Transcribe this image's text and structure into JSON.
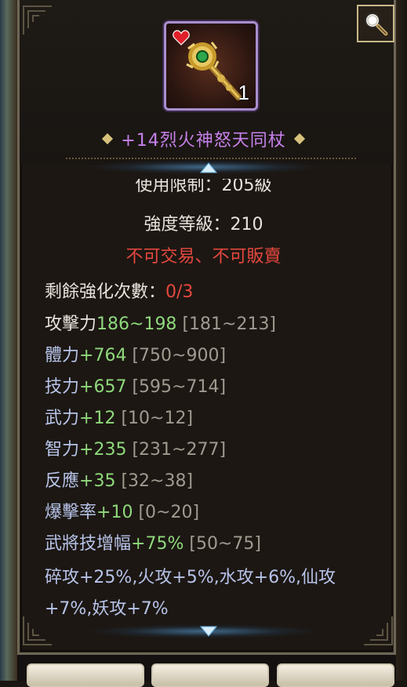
{
  "item": {
    "name": "+14烈火神怒天同杖",
    "count": "1",
    "icon": "staff-icon",
    "favorite_icon": "heart-icon"
  },
  "header": {
    "zoom_icon": "magnifier-icon"
  },
  "info": {
    "use_restriction": "使用限制：205級",
    "strength_level": "強度等級：210",
    "trade_restriction": "不可交易、不可販賣"
  },
  "stats": {
    "remaining_label": "剩餘強化次數：",
    "remaining_value": "0/3",
    "attack_label": "攻擊力",
    "attack_value": "186~198",
    "attack_range": "[181~213]",
    "lines": [
      {
        "label": "體力",
        "value": "+764",
        "range": "[750~900]"
      },
      {
        "label": "技力",
        "value": "+657",
        "range": "[595~714]"
      },
      {
        "label": "武力",
        "value": "+12",
        "range": "[10~12]"
      },
      {
        "label": "智力",
        "value": "+235",
        "range": "[231~277]"
      },
      {
        "label": "反應",
        "value": "+35",
        "range": "[32~38]"
      },
      {
        "label": "爆擊率",
        "value": "+10",
        "range": "[0~20]"
      },
      {
        "label": "武將技增幅",
        "value": "+75%",
        "range": "[50~75]"
      }
    ],
    "elemental_line1": "碎攻+25%,火攻+5%,水攻+6%,仙攻",
    "elemental_line2": "+7%,妖攻+7%"
  },
  "colors": {
    "item_name": "#c681ea",
    "bonus_value": "#8fd97c",
    "restriction": "#e5483e",
    "range": "#a09a90",
    "stat_label": "#b7c3e8"
  }
}
